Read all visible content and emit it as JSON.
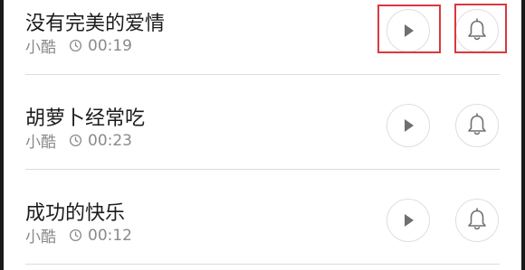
{
  "ringtones": [
    {
      "title": "没有完美的爱情",
      "author": "小酷",
      "duration": "00:19"
    },
    {
      "title": "胡萝卜经常吃",
      "author": "小酷",
      "duration": "00:23"
    },
    {
      "title": "成功的快乐",
      "author": "小酷",
      "duration": "00:12"
    }
  ],
  "icons": {
    "play": "play-icon",
    "bell": "bell-icon",
    "clock": "clock-icon"
  },
  "colors": {
    "highlight": "#d9393e",
    "title_text": "#1c1c1c",
    "meta_text": "#8a8a8a",
    "icon": "#6f6f6f",
    "divider": "#dcdcdc"
  }
}
